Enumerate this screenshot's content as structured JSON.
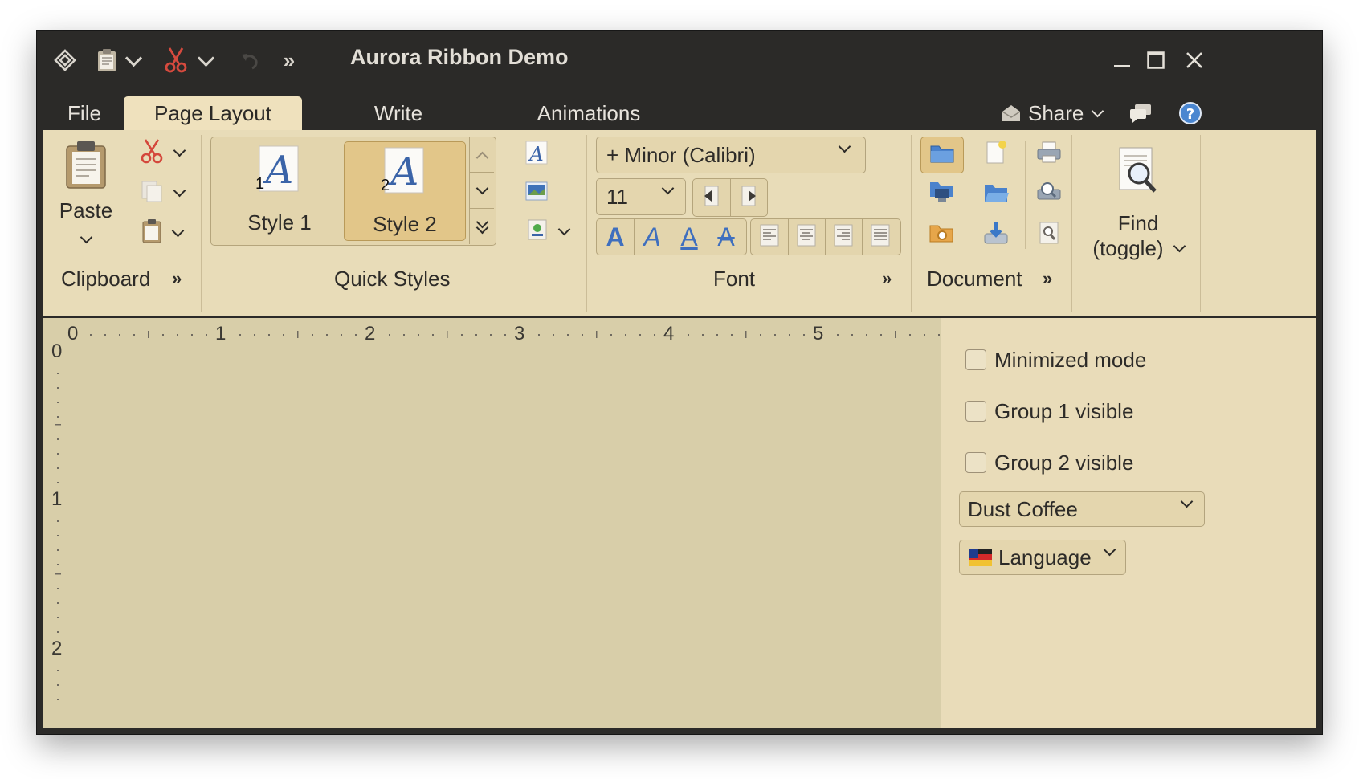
{
  "window": {
    "title": "Aurora Ribbon Demo",
    "controls": {
      "minimize": "minimize-icon",
      "maximize": "maximize-icon",
      "close": "close-icon"
    }
  },
  "quick_access": {
    "items": [
      "app-menu-icon",
      "paste-icon",
      "cut-icon",
      "undo-icon"
    ],
    "overflow": "»"
  },
  "tabs": {
    "file": "File",
    "page_layout": "Page Layout",
    "write": "Write",
    "animations": "Animations",
    "active": "Page Layout"
  },
  "taskbar": {
    "share": "Share",
    "chat_icon": "chat-icon",
    "help_icon": "help-icon"
  },
  "ribbon": {
    "clipboard": {
      "label": "Clipboard",
      "paste": "Paste"
    },
    "quick_styles": {
      "label": "Quick Styles",
      "style1": "Style 1",
      "style2": "Style 2",
      "style1_key": "1",
      "style2_key": "2",
      "glyph": "A",
      "selected": "Style 2"
    },
    "font": {
      "label": "Font",
      "family": "+ Minor (Calibri)",
      "size": "11",
      "style_glyph": "A"
    },
    "document": {
      "label": "Document"
    },
    "find": {
      "line1": "Find",
      "line2": "(toggle)"
    },
    "launcher": "»"
  },
  "ruler": {
    "horizontal": [
      "0",
      "1",
      "2",
      "3",
      "4",
      "5"
    ],
    "vertical": [
      "0",
      "1",
      "2"
    ]
  },
  "options_panel": {
    "minimized_mode": {
      "label": "Minimized mode",
      "checked": false
    },
    "group1_visible": {
      "label": "Group 1 visible",
      "checked": false
    },
    "group2_visible": {
      "label": "Group 2 visible",
      "checked": false
    },
    "skin": "Dust Coffee",
    "language": "Language"
  },
  "colors": {
    "title_bar": "#2b2a28",
    "ribbon_bg": "#e8dcb8",
    "active_tab": "#efe1bd",
    "selected_style": "#e2c689",
    "canvas_bg": "#d8cea9",
    "panel_bg": "#e9dcb9"
  }
}
